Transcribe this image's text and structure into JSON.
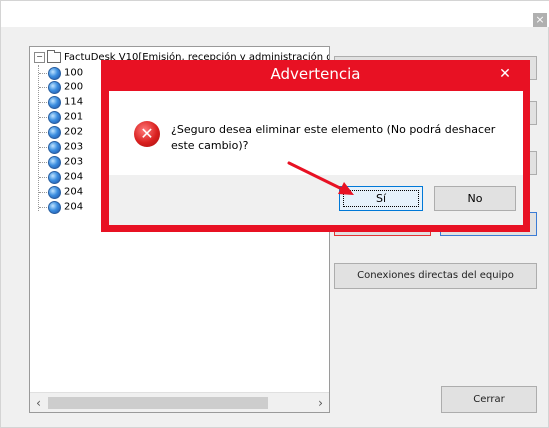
{
  "window": {
    "close_glyph": "×"
  },
  "tree": {
    "root_label": "FactuDesk V10[Emisión, recepción y administración de Co",
    "expander_glyph": "−",
    "items": [
      "100",
      "200",
      "114",
      "201",
      "202",
      "203",
      "203",
      "204",
      "204",
      "204"
    ]
  },
  "scrollbar": {
    "left_glyph": "‹",
    "right_glyph": "›"
  },
  "right_panel": {
    "conexiones_label": "Conexiones directas del equipo",
    "cerrar_label": "Cerrar"
  },
  "dialog": {
    "title": "Advertencia",
    "close_glyph": "✕",
    "icon": "error-icon",
    "icon_glyph": "✕",
    "message": "¿Seguro desea eliminar este elemento (No podrá deshacer este cambio)?",
    "yes_label": "Sí",
    "no_label": "No"
  },
  "colors": {
    "dialog_accent": "#e81123",
    "annotation_arrow": "#e81123",
    "default_button_border": "#0078d7"
  }
}
